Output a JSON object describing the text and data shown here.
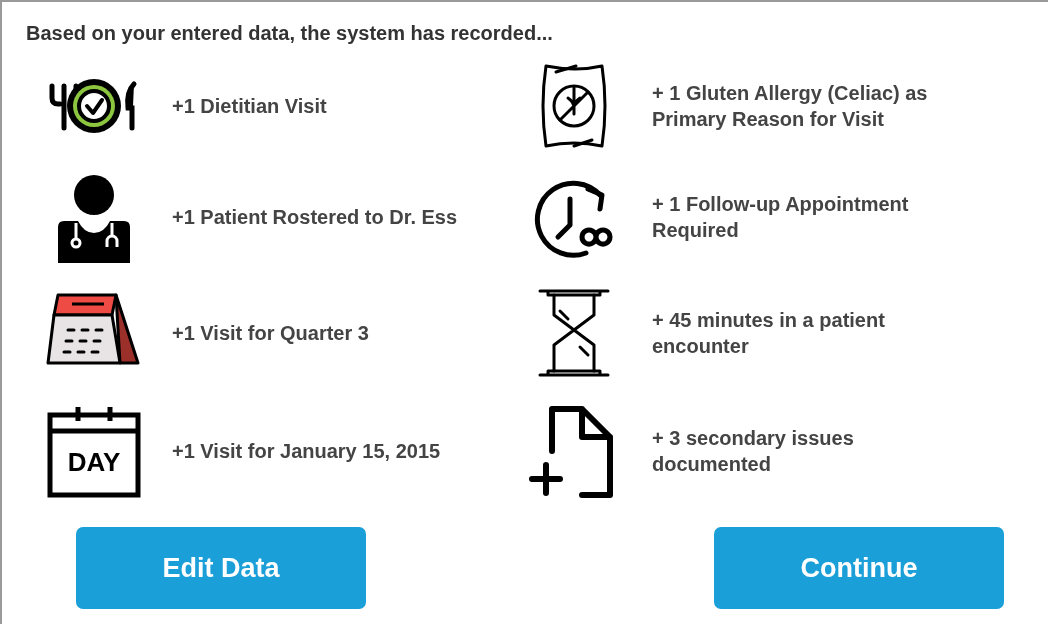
{
  "heading": "Based on your entered data, the system has recorded...",
  "items": [
    {
      "kind": "meal",
      "text": "+1 Dietitian Visit"
    },
    {
      "kind": "gluten",
      "text": "+ 1 Gluten Allergy (Celiac) as Primary Reason for Visit"
    },
    {
      "kind": "doctor",
      "text": "+1 Patient Rostered to Dr. Ess"
    },
    {
      "kind": "followup",
      "text": "+ 1 Follow-up Appointment Required"
    },
    {
      "kind": "desk-calendar",
      "text": "+1 Visit for Quarter 3"
    },
    {
      "kind": "hourglass",
      "text": "+ 45 minutes in a patient encounter"
    },
    {
      "kind": "day-calendar",
      "text": "+1 Visit for January 15, 2015",
      "icon_text": "DAY"
    },
    {
      "kind": "new-file",
      "text": "+ 3 secondary issues documented"
    }
  ],
  "buttons": [
    "Edit Data",
    "Continue"
  ]
}
